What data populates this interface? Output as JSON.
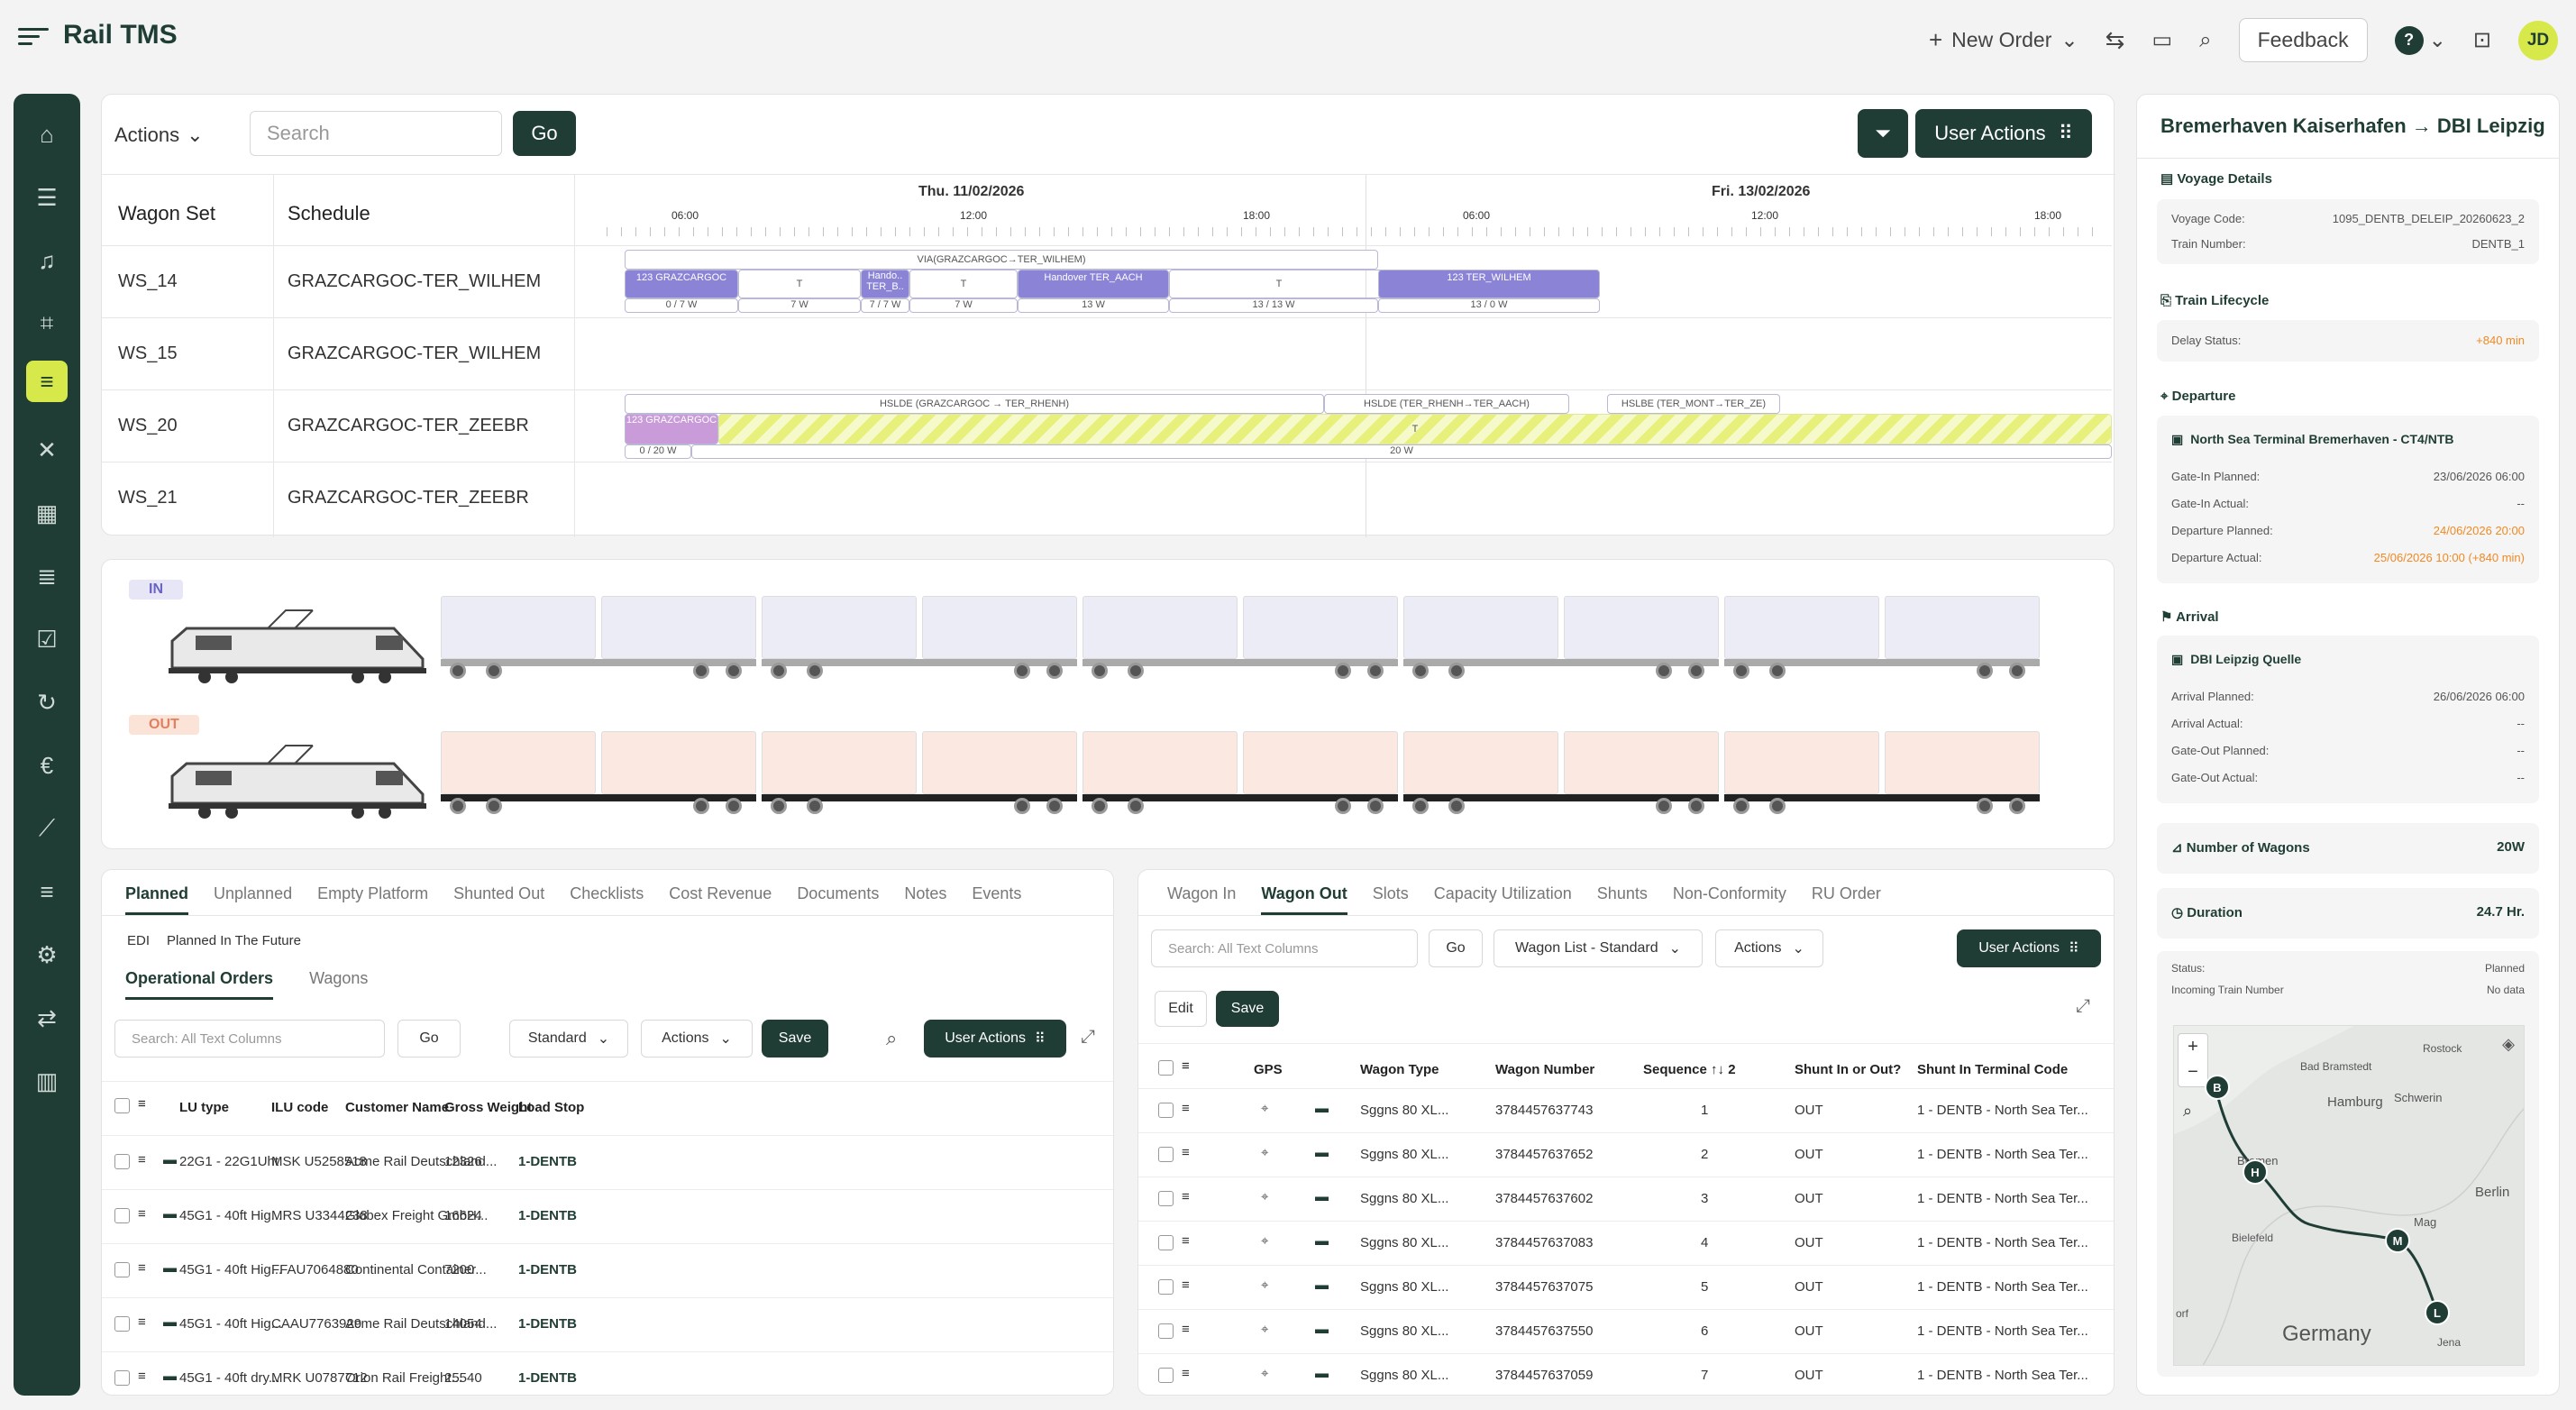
{
  "app": {
    "title": "Rail TMS"
  },
  "topbar": {
    "new_order": "New Order",
    "feedback": "Feedback",
    "avatar": "JD",
    "help": "?"
  },
  "toolbar": {
    "actions": "Actions",
    "search_placeholder": "Search",
    "go": "Go",
    "user_actions": "User Actions"
  },
  "gantt": {
    "col_wagon_set": "Wagon Set",
    "col_schedule": "Schedule",
    "day1": "Thu. 11/02/2026",
    "day2": "Fri. 13/02/2026",
    "ticks": [
      "06:00",
      "12:00",
      "18:00",
      "06:00",
      "12:00",
      "18:00"
    ],
    "rows": [
      {
        "set": "WS_14",
        "schedule": "GRAZCARGOC-TER_WILHEM"
      },
      {
        "set": "WS_15",
        "schedule": "GRAZCARGOC-TER_WILHEM"
      },
      {
        "set": "WS_20",
        "schedule": "GRAZCARGOC-TER_ZEEBR"
      },
      {
        "set": "WS_21",
        "schedule": "GRAZCARGOC-TER_ZEEBR"
      }
    ],
    "ws14_via": "VIA(GRAZCARGOC→TER_WILHEM)",
    "ws14_blocks": [
      {
        "t": "123 GRAZCARGOC",
        "b": "0 / 7 W"
      },
      {
        "t": "T",
        "b": "7 W"
      },
      {
        "t": "Hando.. TER_B..",
        "b": "7 / 7 W"
      },
      {
        "t": "T",
        "b": "7 W"
      },
      {
        "t": "Handover TER_AACH",
        "b": "13 W"
      },
      {
        "t": "T",
        "b": "13 / 13 W"
      },
      {
        "t": "123 TER_WILHEM",
        "b": "13 / 0 W"
      }
    ],
    "ws20_legs": [
      "HSLDE (GRAZCARGOC → TER_RHENH)",
      "HSLDE (TER_RHENH→TER_AACH)",
      "HSLBE (TER_MONT→TER_ZE)"
    ],
    "ws20_blocks": [
      {
        "t": "123 GRAZCARGOC",
        "b": "0 / 20 W"
      },
      {
        "t": "T",
        "b": "20 W"
      }
    ]
  },
  "train": {
    "in": "IN",
    "out": "OUT"
  },
  "left_panel": {
    "tabs": [
      "Planned",
      "Unplanned",
      "Empty Platform",
      "Shunted Out",
      "Checklists",
      "Cost Revenue",
      "Documents",
      "Notes",
      "Events"
    ],
    "sub_edi": "EDI",
    "sub_future": "Planned In The Future",
    "subtabs": [
      "Operational Orders",
      "Wagons"
    ],
    "search_placeholder": "Search: All Text Columns",
    "go": "Go",
    "view": "Standard",
    "actions": "Actions",
    "save": "Save",
    "user_actions": "User Actions",
    "columns": [
      "LU type",
      "ILU code",
      "Customer Name",
      "Gross Weight",
      "Load Stop"
    ],
    "rows": [
      [
        "22G1 - 22G1Uht",
        "MSK U5258518",
        "Acme Rail Deutschland...",
        "12326",
        "1-DENTB"
      ],
      [
        "45G1 - 40ft Hig...",
        "MRS U3344238",
        "Globex Freight GmbH...",
        "16624",
        "1-DENTB"
      ],
      [
        "45G1 - 40ft Hig...",
        "FFAU7064880",
        "Continental Container...",
        "7200",
        "1-DENTB"
      ],
      [
        "45G1 - 40ft Hig...",
        "CAAU7763929",
        "Acme Rail Deutschland...",
        "14054",
        "1-DENTB"
      ],
      [
        "45G1 - 40ft dry...",
        "MRK U0787712",
        "Orion Rail Freight...",
        "25540",
        "1-DENTB"
      ]
    ]
  },
  "right_panel": {
    "tabs": [
      "Wagon In",
      "Wagon Out",
      "Slots",
      "Capacity Utilization",
      "Shunts",
      "Non-Conformity",
      "RU Order"
    ],
    "search_placeholder": "Search: All Text Columns",
    "go": "Go",
    "view": "Wagon List - Standard",
    "actions": "Actions",
    "user_actions": "User Actions",
    "edit": "Edit",
    "save": "Save",
    "columns": [
      "GPS",
      "Wagon Type",
      "Wagon Number",
      "Sequence ↑↓ 2",
      "Shunt In or Out?",
      "Shunt In Terminal Code"
    ],
    "rows": [
      [
        "Sggns 80 XL...",
        "3784457637743",
        "1",
        "OUT",
        "1 - DENTB - North Sea Ter..."
      ],
      [
        "Sggns 80 XL...",
        "3784457637652",
        "2",
        "OUT",
        "1 - DENTB - North Sea Ter..."
      ],
      [
        "Sggns 80 XL...",
        "3784457637602",
        "3",
        "OUT",
        "1 - DENTB - North Sea Ter..."
      ],
      [
        "Sggns 80 XL...",
        "3784457637083",
        "4",
        "OUT",
        "1 - DENTB - North Sea Ter..."
      ],
      [
        "Sggns 80 XL...",
        "3784457637075",
        "5",
        "OUT",
        "1 - DENTB - North Sea Ter..."
      ],
      [
        "Sggns 80 XL...",
        "3784457637550",
        "6",
        "OUT",
        "1 - DENTB - North Sea Ter..."
      ],
      [
        "Sggns 80 XL...",
        "3784457637059",
        "7",
        "OUT",
        "1 - DENTB - North Sea Ter..."
      ]
    ]
  },
  "voyage": {
    "title": "Bremerhaven Kaiserhafen → DBI Leipzig",
    "details_h": "Voyage Details",
    "code_l": "Voyage Code:",
    "code_v": "1095_DENTB_DELEIP_20260623_2",
    "train_l": "Train Number:",
    "train_v": "DENTB_1",
    "life_h": "Train Lifecycle",
    "delay_l": "Delay Status:",
    "delay_v": "+840 min",
    "dep_h": "Departure",
    "dep_term": "North Sea Terminal Bremerhaven - CT4/NTB",
    "dep_rows": [
      [
        "Gate-In Planned:",
        "23/06/2026 06:00"
      ],
      [
        "Gate-In Actual:",
        "--"
      ],
      [
        "Departure Planned:",
        "24/06/2026 20:00"
      ],
      [
        "Departure Actual:",
        "25/06/2026 10:00 (+840 min)"
      ]
    ],
    "arr_h": "Arrival",
    "arr_term": "DBI Leipzig Quelle",
    "arr_rows": [
      [
        "Arrival Planned:",
        "26/06/2026 06:00"
      ],
      [
        "Arrival Actual:",
        "--"
      ],
      [
        "Gate-Out Planned:",
        "--"
      ],
      [
        "Gate-Out Actual:",
        "--"
      ]
    ],
    "wagons_l": "Number of Wagons",
    "wagons_v": "20W",
    "dur_l": "Duration",
    "dur_v": "24.7 Hr.",
    "status_l": "Status:",
    "status_v": "Planned",
    "incoming_l": "Incoming Train Number",
    "incoming_v": "No data"
  },
  "map": {
    "labels": [
      "Bad Bramstedt",
      "Rostock",
      "Hamburg",
      "Schwerin",
      "Bremen",
      "Berlin",
      "Bielefeld",
      "Germany",
      "orf",
      "Jena",
      "Mag"
    ],
    "markers": [
      "B",
      "H",
      "M",
      "L"
    ]
  },
  "colors": {
    "brand": "#1f3d35",
    "accent": "#d6e84a",
    "delay": "#f08a24",
    "purple": "#8a83d6"
  }
}
